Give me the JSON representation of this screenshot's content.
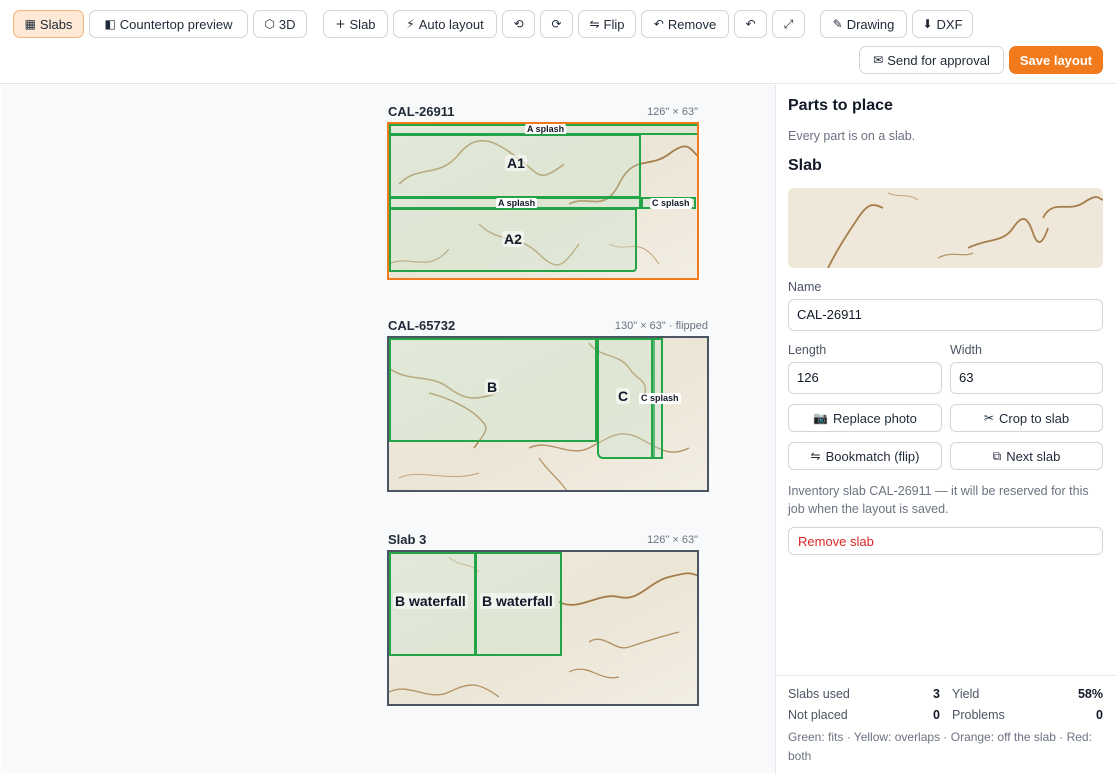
{
  "toolbar": {
    "slabs": {
      "icon": "grid-icon",
      "glyph": "▦",
      "label": "Slabs"
    },
    "countertop_preview": {
      "icon": "half-square-icon",
      "glyph": "◧",
      "label": "Countertop preview"
    },
    "view_3d": {
      "icon": "hexagon-icon",
      "glyph": "⬡",
      "label": "3D"
    },
    "add_slab": {
      "icon": "plus-icon",
      "glyph": "+",
      "label": "Slab"
    },
    "auto_layout": {
      "icon": "lightning-icon",
      "glyph": "⚡",
      "label": "Auto layout"
    },
    "rotate_left": {
      "icon": "rotate-left-icon",
      "glyph": "⟲"
    },
    "rotate_right": {
      "icon": "rotate-right-icon",
      "glyph": "⟳"
    },
    "flip": {
      "icon": "flip-icon",
      "glyph": "⇋",
      "label": "Flip"
    },
    "remove": {
      "icon": "undo-arrow-icon",
      "glyph": "↶",
      "label": "Remove"
    },
    "undo": {
      "icon": "undo-icon",
      "glyph": "↶"
    },
    "fullscreen": {
      "icon": "expand-icon",
      "glyph": "⤢"
    },
    "drawing": {
      "icon": "pencil-icon",
      "glyph": "✎",
      "label": "Drawing"
    },
    "dxf": {
      "icon": "download-icon",
      "glyph": "⬇",
      "label": "DXF"
    },
    "send_approval": {
      "icon": "envelope-icon",
      "glyph": "✉",
      "label": "Send for approval"
    },
    "save_layout": {
      "label": "Save layout"
    }
  },
  "slabs": [
    {
      "name": "CAL-26911",
      "dims": "126\" × 63\"",
      "parts": [
        {
          "label": "A splash"
        },
        {
          "label": "A1"
        },
        {
          "label": "A splash"
        },
        {
          "label": "C splash"
        },
        {
          "label": "A2"
        }
      ]
    },
    {
      "name": "CAL-65732",
      "dims": "130\" × 63\" · flipped",
      "parts": [
        {
          "label": "B"
        },
        {
          "label": "C"
        },
        {
          "label": "C splash"
        }
      ]
    },
    {
      "name": "Slab 3",
      "dims": "126\" × 63\"",
      "parts": [
        {
          "label": "B waterfall"
        },
        {
          "label": "B waterfall"
        }
      ]
    }
  ],
  "side": {
    "parts_title": "Parts to place",
    "parts_status": "Every part is on a slab.",
    "slab_title": "Slab",
    "name_label": "Name",
    "name_value": "CAL-26911",
    "length_label": "Length",
    "length_value": "126",
    "width_label": "Width",
    "width_value": "63",
    "replace_photo": {
      "icon": "camera-icon",
      "glyph": "📷",
      "label": "Replace photo"
    },
    "crop_to_slab": {
      "icon": "scissors-icon",
      "glyph": "✂",
      "label": "Crop to slab"
    },
    "bookmatch": {
      "icon": "flip-icon",
      "glyph": "⇋",
      "label": "Bookmatch (flip)"
    },
    "next_slab": {
      "icon": "copy-icon",
      "glyph": "⧉",
      "label": "Next slab"
    },
    "inventory_note": "Inventory slab CAL-26911 — it will be reserved for this job when the layout is saved.",
    "remove_slab": "Remove slab"
  },
  "stats": {
    "slabs_used_label": "Slabs used",
    "slabs_used": "3",
    "yield_label": "Yield",
    "yield": "58%",
    "not_placed_label": "Not placed",
    "not_placed": "0",
    "problems_label": "Problems",
    "problems": "0",
    "legend": "Green: fits · Yellow: overlaps · Orange: off the slab · Red: both"
  },
  "colors": {
    "accent": "#f07a1c",
    "fit": "#22a447",
    "off_slab": "#f07a1c",
    "danger": "#dc2626"
  }
}
